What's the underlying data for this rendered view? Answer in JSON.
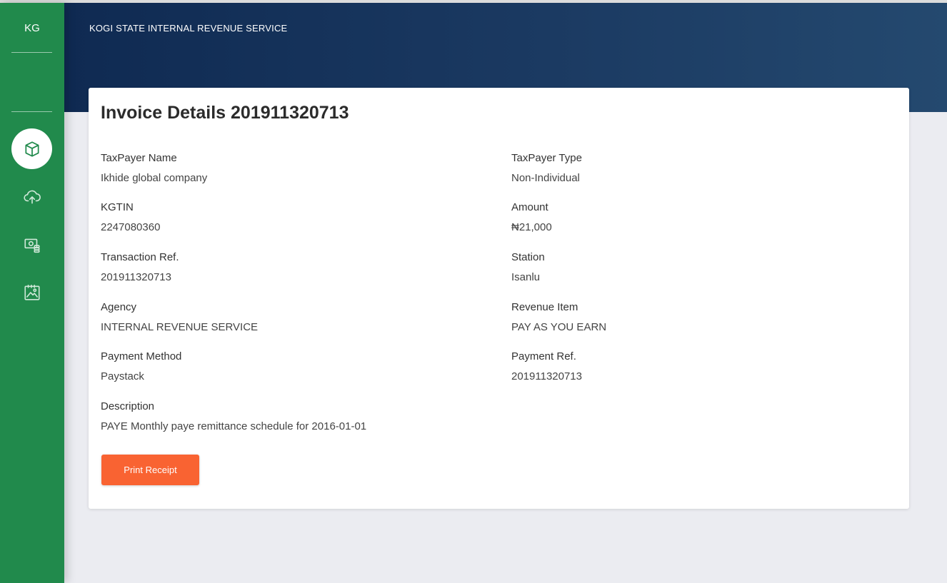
{
  "sidebar": {
    "brand": "KG",
    "items": [
      {
        "icon": "package-icon",
        "active": true
      },
      {
        "icon": "cloud-upload-icon",
        "active": false
      },
      {
        "icon": "money-icon",
        "active": false
      },
      {
        "icon": "image-report-icon",
        "active": false
      }
    ]
  },
  "header": {
    "title": "KOGI STATE INTERNAL REVENUE SERVICE"
  },
  "invoice": {
    "title": "Invoice Details 201911320713",
    "fields": {
      "taxpayer_name": {
        "label": "TaxPayer Name",
        "value": "Ikhide global company"
      },
      "taxpayer_type": {
        "label": "TaxPayer Type",
        "value": "Non-Individual"
      },
      "kgtin": {
        "label": "KGTIN",
        "value": "2247080360"
      },
      "amount": {
        "label": "Amount",
        "value": "₦21,000"
      },
      "transaction_ref": {
        "label": "Transaction Ref.",
        "value": "201911320713"
      },
      "station": {
        "label": "Station",
        "value": "Isanlu"
      },
      "agency": {
        "label": "Agency",
        "value": "INTERNAL REVENUE SERVICE"
      },
      "revenue_item": {
        "label": "Revenue Item",
        "value": "PAY AS YOU EARN"
      },
      "payment_method": {
        "label": "Payment Method",
        "value": "Paystack"
      },
      "payment_ref": {
        "label": "Payment Ref.",
        "value": "201911320713"
      },
      "description": {
        "label": "Description",
        "value": "PAYE Monthly paye remittance schedule for 2016-01-01"
      }
    },
    "print_button": "Print Receipt"
  },
  "colors": {
    "sidebar": "#218a4c",
    "header_start": "#0f2a52",
    "header_end": "#24496f",
    "button": "#f96332",
    "background": "#ebecf1"
  }
}
